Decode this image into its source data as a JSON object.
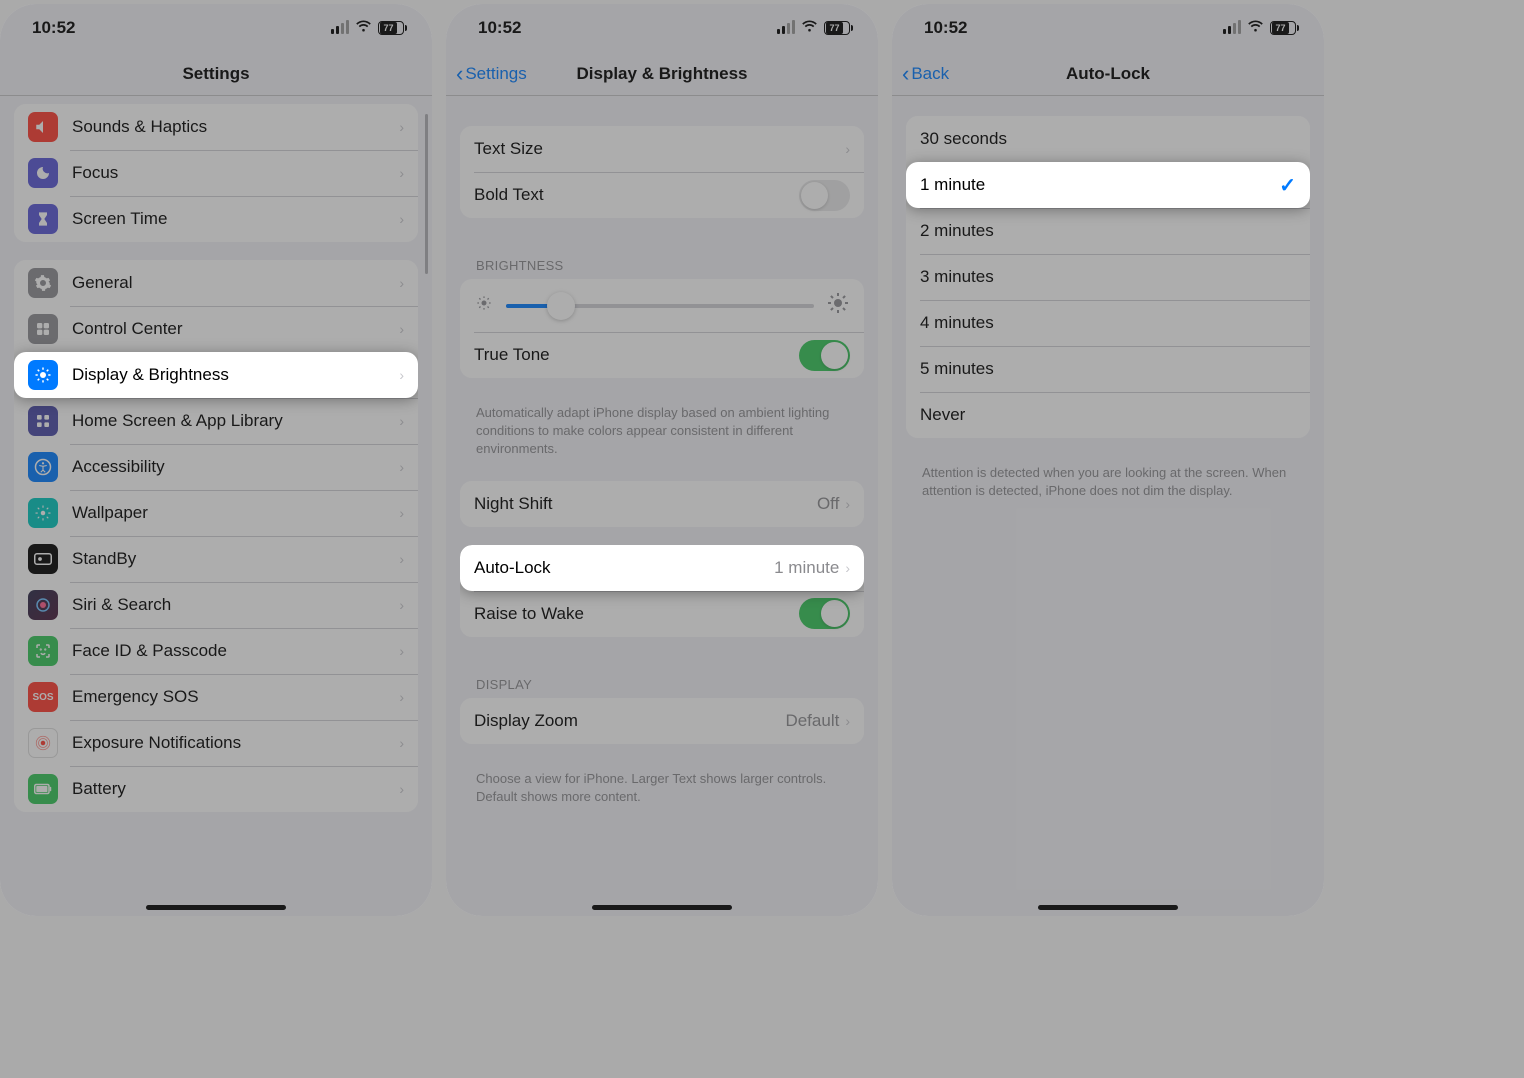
{
  "status": {
    "time": "10:52",
    "battery_pct": "77"
  },
  "screen1": {
    "title": "Settings",
    "groups": [
      [
        {
          "icon": "sounds",
          "bg": "#ff3b30",
          "label": "Sounds & Haptics"
        },
        {
          "icon": "focus",
          "bg": "#5856d6",
          "label": "Focus"
        },
        {
          "icon": "screentime",
          "bg": "#5856d6",
          "label": "Screen Time"
        }
      ],
      [
        {
          "icon": "general",
          "bg": "#8e8e93",
          "label": "General"
        },
        {
          "icon": "control",
          "bg": "#8e8e93",
          "label": "Control Center"
        },
        {
          "icon": "display",
          "bg": "#007aff",
          "label": "Display & Brightness",
          "highlight": true
        },
        {
          "icon": "home",
          "bg": "#3a3a8f",
          "label": "Home Screen & App Library"
        },
        {
          "icon": "accessibility",
          "bg": "#007aff",
          "label": "Accessibility"
        },
        {
          "icon": "wallpaper",
          "bg": "#00c7be",
          "label": "Wallpaper"
        },
        {
          "icon": "standby",
          "bg": "#000000",
          "label": "StandBy"
        },
        {
          "icon": "siri",
          "bg": "#1c1c1e",
          "label": "Siri & Search"
        },
        {
          "icon": "faceid",
          "bg": "#34c759",
          "label": "Face ID & Passcode"
        },
        {
          "icon": "sos",
          "bg": "#ff3b30",
          "label": "Emergency SOS"
        },
        {
          "icon": "exposure",
          "bg": "#ffffff",
          "label": "Exposure Notifications"
        },
        {
          "icon": "battery",
          "bg": "#34c759",
          "label": "Battery"
        }
      ]
    ]
  },
  "screen2": {
    "back": "Settings",
    "title": "Display & Brightness",
    "text_size": "Text Size",
    "bold_text": "Bold Text",
    "brightness_header": "BRIGHTNESS",
    "brightness_pct": 18,
    "true_tone": "True Tone",
    "true_tone_footer": "Automatically adapt iPhone display based on ambient lighting conditions to make colors appear consistent in different environments.",
    "night_shift": "Night Shift",
    "night_shift_val": "Off",
    "auto_lock": "Auto-Lock",
    "auto_lock_val": "1 minute",
    "raise_to_wake": "Raise to Wake",
    "display_header": "DISPLAY",
    "display_zoom": "Display Zoom",
    "display_zoom_val": "Default",
    "display_zoom_footer": "Choose a view for iPhone. Larger Text shows larger controls. Default shows more content."
  },
  "screen3": {
    "back": "Back",
    "title": "Auto-Lock",
    "options": [
      {
        "label": "30 seconds",
        "selected": false
      },
      {
        "label": "1 minute",
        "selected": true
      },
      {
        "label": "2 minutes",
        "selected": false
      },
      {
        "label": "3 minutes",
        "selected": false
      },
      {
        "label": "4 minutes",
        "selected": false
      },
      {
        "label": "5 minutes",
        "selected": false
      },
      {
        "label": "Never",
        "selected": false
      }
    ],
    "footer": "Attention is detected when you are looking at the screen. When attention is detected, iPhone does not dim the display."
  }
}
